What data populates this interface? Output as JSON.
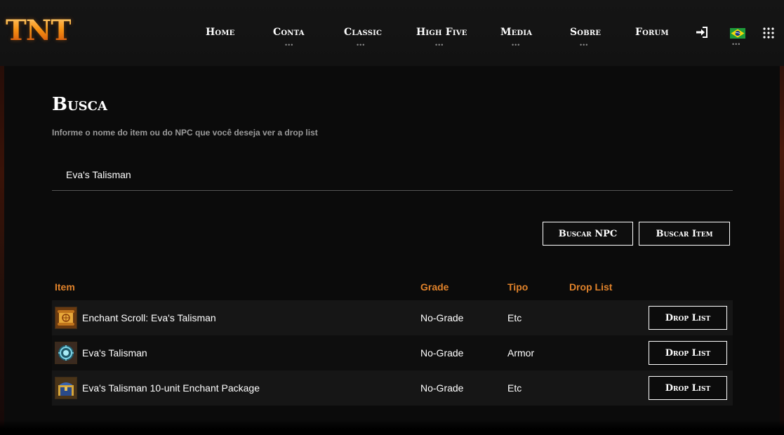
{
  "header": {
    "logo_text": "TNT",
    "nav": [
      {
        "label": "Home",
        "has_dots": false
      },
      {
        "label": "Conta",
        "has_dots": true
      },
      {
        "label": "Classic",
        "has_dots": true
      },
      {
        "label": "High Five",
        "has_dots": true
      },
      {
        "label": "Media",
        "has_dots": true
      },
      {
        "label": "Sobre",
        "has_dots": true
      },
      {
        "label": "Forum",
        "has_dots": false
      }
    ],
    "dots": "•••",
    "icons": {
      "login": "sign-in-icon",
      "flag": "brazil-flag-icon",
      "apps": "apps-grid-icon"
    }
  },
  "main": {
    "title": "Busca",
    "subtitle": "Informe o nome do item ou do NPC que você deseja ver a drop list",
    "search": {
      "value": "Eva's Talisman",
      "placeholder": ""
    },
    "buttons": {
      "npc": "Buscar NPC",
      "item": "Buscar Item"
    },
    "table": {
      "headers": {
        "item": "Item",
        "grade": "Grade",
        "tipo": "Tipo",
        "drop": "Drop List"
      },
      "rows": [
        {
          "name": "Enchant Scroll: Eva's Talisman",
          "grade": "No-Grade",
          "tipo": "Etc",
          "button": "Drop List",
          "icon": "scroll-icon"
        },
        {
          "name": "Eva's Talisman",
          "grade": "No-Grade",
          "tipo": "Armor",
          "button": "Drop List",
          "icon": "talisman-icon"
        },
        {
          "name": "Eva's Talisman 10-unit Enchant Package",
          "grade": "No-Grade",
          "tipo": "Etc",
          "button": "Drop List",
          "icon": "treasure-chest-icon"
        }
      ]
    }
  },
  "colors": {
    "accent_orange": "#e0822a",
    "background": "#0b0b0b",
    "row_alt": "#161616"
  }
}
